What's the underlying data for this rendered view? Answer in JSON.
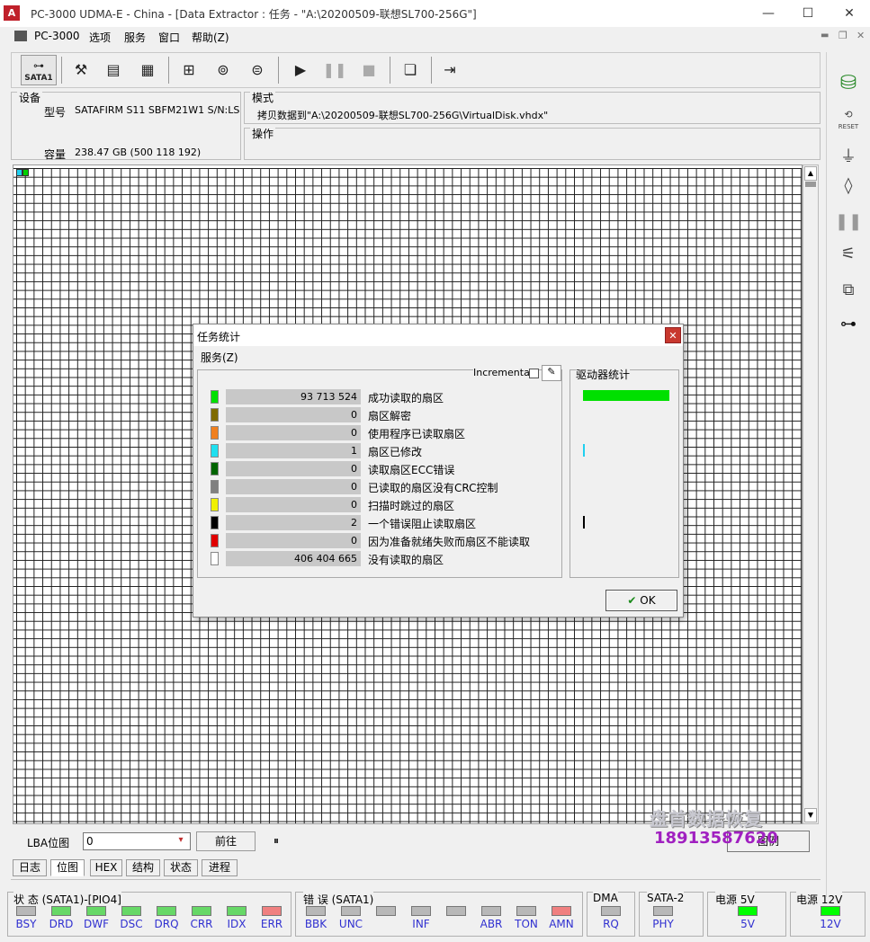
{
  "window": {
    "title": "PC-3000 UDMA-E - China - [Data Extractor : 任务 - \"A:\\20200509-联想SL700-256G\"]",
    "logo_text": "A",
    "min": "—",
    "max": "☐",
    "close": "✕"
  },
  "menu": {
    "items": [
      "PC-3000",
      "选项",
      "服务",
      "窗口",
      "帮助(Z)"
    ]
  },
  "toolbar": {
    "sata_label": "SATA1"
  },
  "device": {
    "group_label": "设备",
    "model_label": "型号",
    "model_value": "SATAFIRM   S11 SBFM21W1 S/N:LSL",
    "capacity_label": "容量",
    "capacity_value": "238.47 GB (500 118 192)"
  },
  "mode": {
    "group_label": "模式",
    "value": "拷贝数据到\"A:\\20200509-联想SL700-256G\\VirtualDisk.vhdx\"",
    "operation_label": "操作"
  },
  "lba": {
    "label": "LBA位图",
    "value": "0",
    "goto_button": "前往",
    "pause_glyph": "⏸",
    "legend_button": "图例"
  },
  "tabs": [
    "日志",
    "位图",
    "HEX",
    "结构",
    "状态",
    "进程"
  ],
  "status_sata": {
    "title": "状 态 (SATA1)-[PIO4]",
    "indicators": [
      {
        "label": "BSY",
        "state": "off"
      },
      {
        "label": "DRD",
        "state": "green"
      },
      {
        "label": "DWF",
        "state": "green"
      },
      {
        "label": "DSC",
        "state": "green"
      },
      {
        "label": "DRQ",
        "state": "green"
      },
      {
        "label": "CRR",
        "state": "green"
      },
      {
        "label": "IDX",
        "state": "green"
      },
      {
        "label": "ERR",
        "state": "red"
      }
    ]
  },
  "errors": {
    "title": "错 误 (SATA1)",
    "indicators": [
      {
        "label": "BBK",
        "state": "off"
      },
      {
        "label": "UNC",
        "state": "off"
      },
      {
        "label": "",
        "state": "off"
      },
      {
        "label": "INF",
        "state": "off"
      },
      {
        "label": "",
        "state": "off"
      },
      {
        "label": "ABR",
        "state": "off"
      },
      {
        "label": "TON",
        "state": "off"
      },
      {
        "label": "AMN",
        "state": "red"
      }
    ]
  },
  "dma": {
    "title": "DMA",
    "label": "RQ"
  },
  "sata2": {
    "title": "SATA-2",
    "label": "PHY"
  },
  "power5": {
    "title": "电源 5V",
    "label": "5V"
  },
  "power12": {
    "title": "电源 12V",
    "label": "12V"
  },
  "dialog": {
    "title": "任务统计",
    "menu": "服务(Z)",
    "incremental_label": "Incremental",
    "drive_stats_label": "驱动器统计",
    "ok_button": "OK",
    "rows": [
      {
        "color": "#00e000",
        "value": "93 713 524",
        "label": "成功读取的扇区"
      },
      {
        "color": "#7f6b00",
        "value": "0",
        "label": "扇区解密"
      },
      {
        "color": "#f08020",
        "value": "0",
        "label": "使用程序已读取扇区"
      },
      {
        "color": "#20e0f0",
        "value": "1",
        "label": "扇区已修改"
      },
      {
        "color": "#006400",
        "value": "0",
        "label": "读取扇区ECC错误"
      },
      {
        "color": "#808080",
        "value": "0",
        "label": "已读取的扇区没有CRC控制"
      },
      {
        "color": "#f0f000",
        "value": "0",
        "label": "扫描时跳过的扇区"
      },
      {
        "color": "#000000",
        "value": "2",
        "label": "一个错误阻止读取扇区"
      },
      {
        "color": "#e00000",
        "value": "0",
        "label": "因为准备就绪失败而扇区不能读取"
      },
      {
        "color": "#ffffff",
        "value": "406 404 665",
        "label": "没有读取的扇区"
      }
    ],
    "drive_bars": [
      {
        "row": 0,
        "color": "#00e000",
        "fraction": 1.0
      },
      {
        "row": 3,
        "color": "#20d0f0",
        "fraction": 0.01
      },
      {
        "row": 7,
        "color": "#000000",
        "fraction": 0.01
      }
    ]
  },
  "watermark": {
    "company": "盘首数据恢复",
    "phone": "18913587620"
  }
}
